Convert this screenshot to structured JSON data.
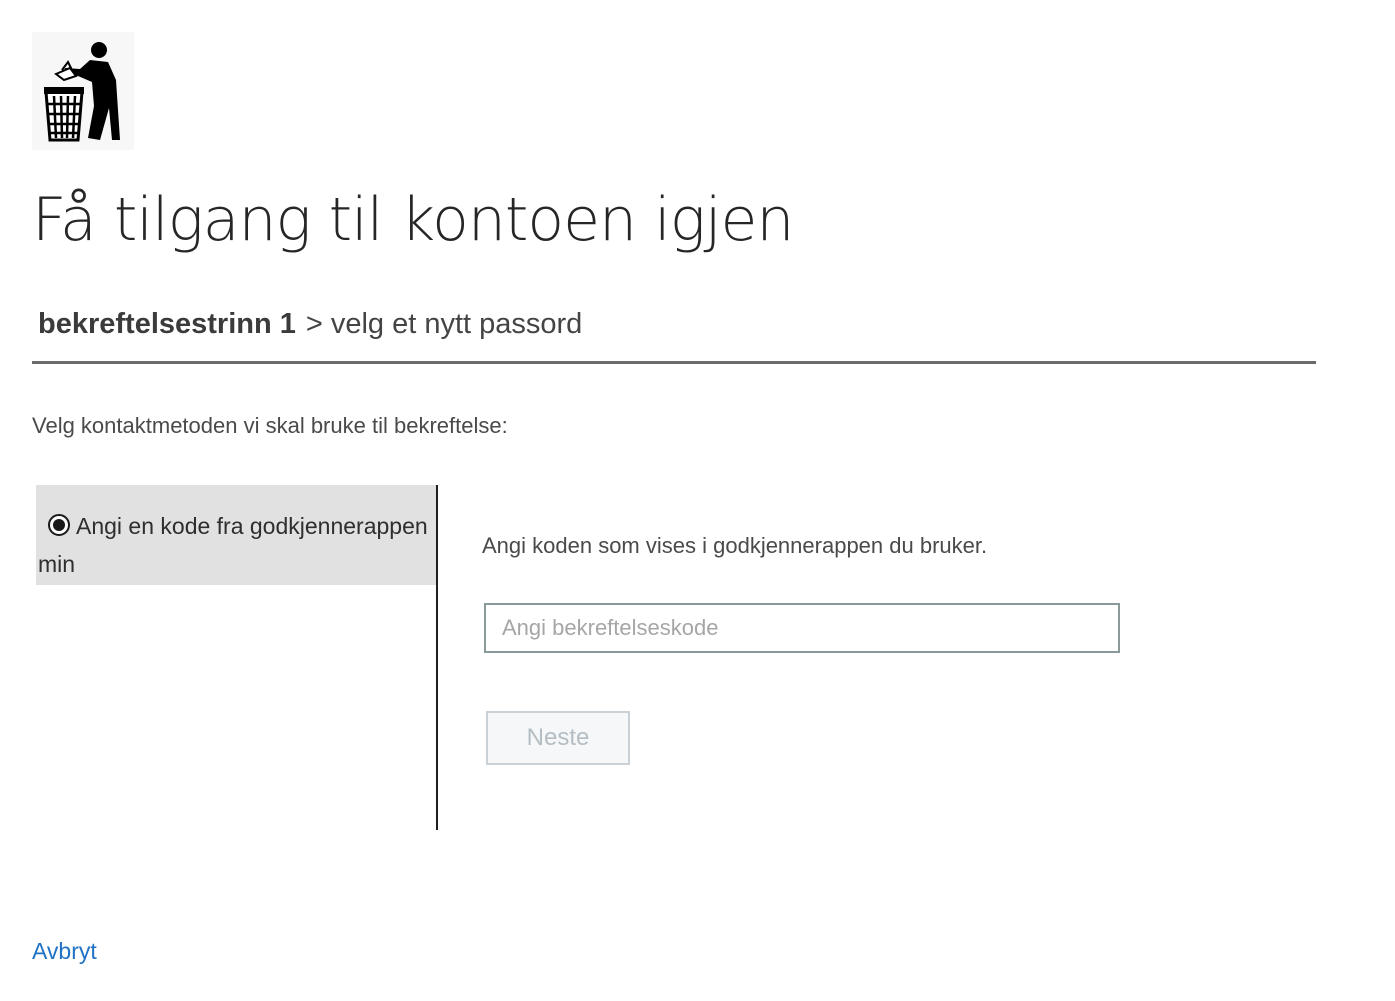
{
  "header": {
    "logo_icon": "tidy-man-trash-icon",
    "title": "Få tilgang til kontoen igjen"
  },
  "steps": {
    "current": "bekreftelsestrinn 1",
    "separator": ">",
    "next": "velg et nytt passord"
  },
  "prompt": "Velg kontaktmetoden vi skal bruke til bekreftelse:",
  "methods": {
    "items": [
      {
        "label": "Angi en kode fra godkjennerappen min",
        "selected": true
      }
    ]
  },
  "verification": {
    "instruction": "Angi koden som vises i godkjennerappen du bruker.",
    "input_value": "",
    "input_placeholder": "Angi bekreftelseskode",
    "next_label": "Neste"
  },
  "footer": {
    "cancel_label": "Avbryt"
  },
  "colors": {
    "link": "#1f72c4",
    "selected_method_bg": "#e1e1e1",
    "underline": "#6b6b6b",
    "disabled_text": "#b4bec4"
  }
}
